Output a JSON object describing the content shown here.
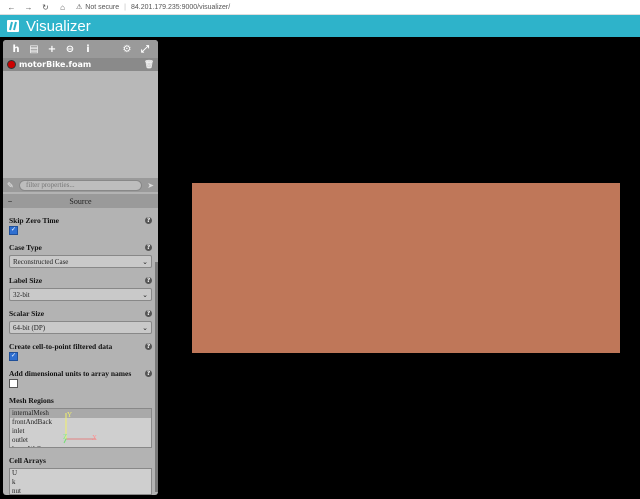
{
  "browser": {
    "url": "84.201.179.235:9000/visualizer/",
    "security": "Not secure"
  },
  "app": {
    "title": "Visualizer",
    "brand_color": "#2eb3ca"
  },
  "toolbar": {
    "icons": [
      "home-icon",
      "file-icon",
      "plus-icon",
      "layers-icon",
      "info-icon",
      "settings-icon",
      "fullscreen-icon"
    ]
  },
  "pipeline": {
    "items": [
      {
        "label": "motorBike.foam"
      }
    ]
  },
  "filter": {
    "placeholder": "filter properties..."
  },
  "section": {
    "title": "Source"
  },
  "props": {
    "skip_zero_time": {
      "label": "Skip Zero Time",
      "checked": true
    },
    "case_type": {
      "label": "Case Type",
      "value": "Reconstructed Case"
    },
    "label_size": {
      "label": "Label Size",
      "value": "32-bit"
    },
    "scalar_size": {
      "label": "Scalar Size",
      "value": "64-bit (DP)"
    },
    "create_c2p": {
      "label": "Create cell-to-point filtered data",
      "checked": true
    },
    "dim_units": {
      "label": "Add dimensional units to array names",
      "checked": false
    },
    "mesh_regions": {
      "label": "Mesh Regions",
      "items": [
        "internalMesh",
        "frontAndBack",
        "inlet",
        "outlet",
        "lowerWall"
      ]
    },
    "cell_arrays": {
      "label": "Cell Arrays",
      "items": [
        "U",
        "k",
        "nut"
      ]
    }
  },
  "axes": {
    "y": "Y",
    "z": "Z",
    "x": "X"
  },
  "viewport": {
    "color": "#bf7759"
  }
}
